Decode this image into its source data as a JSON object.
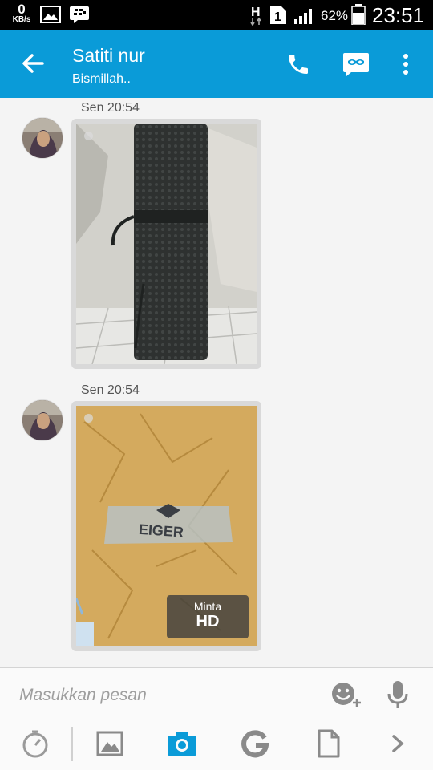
{
  "status_bar": {
    "speed_value": "0",
    "speed_unit": "KB/s",
    "sim_label": "1",
    "network_label": "H",
    "battery_percent": "62%",
    "time": "23:51",
    "icons": [
      "image-icon",
      "bbm-icon",
      "signal-icon",
      "battery-icon"
    ]
  },
  "header": {
    "contact_name": "Satiti nur",
    "status_message": "Bismillah..",
    "accent_color": "#0a9bd8",
    "icons": [
      "back-arrow-icon",
      "phone-icon",
      "voice-chat-icon",
      "more-vert-icon"
    ]
  },
  "messages": [
    {
      "timestamp": "Sen 20:54",
      "type": "photo",
      "content": "black rolled mat leaning against wall"
    },
    {
      "timestamp": "Sen 20:54",
      "type": "photo",
      "content": "yellow package with brand logo",
      "hd_request": {
        "label": "Minta",
        "value": "HD"
      }
    }
  ],
  "composer": {
    "placeholder": "Masukkan pesan",
    "icons": [
      "emoticon-add-icon",
      "microphone-icon"
    ],
    "tools": [
      "timer-icon",
      "gallery-icon",
      "camera-icon",
      "glympse-icon",
      "file-icon",
      "chevron-right-icon"
    ],
    "active_tool_color": "#0a9bd8"
  }
}
